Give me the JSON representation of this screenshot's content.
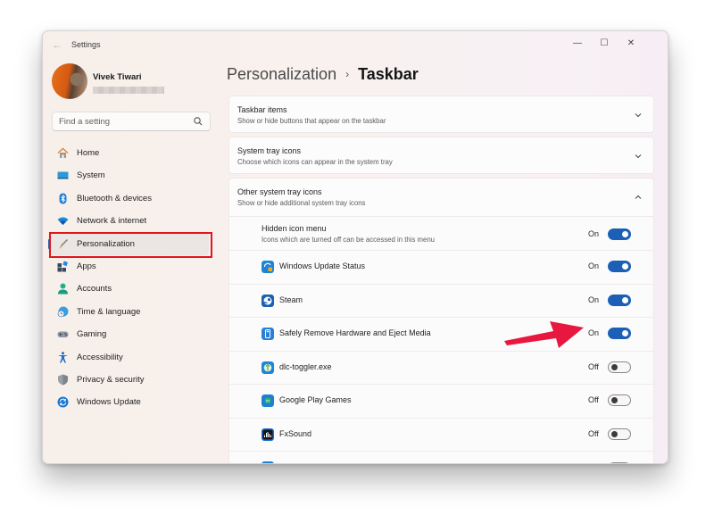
{
  "window": {
    "title": "Settings",
    "controls": {
      "minimize": "—",
      "maximize": "☐",
      "close": "✕"
    },
    "back_icon": "←"
  },
  "profile": {
    "name": "Vivek Tiwari",
    "email": ""
  },
  "search": {
    "placeholder": "Find a setting",
    "value": ""
  },
  "sidebar": {
    "items": [
      {
        "label": "Home",
        "icon": "home-icon",
        "active": false
      },
      {
        "label": "System",
        "icon": "system-icon",
        "active": false
      },
      {
        "label": "Bluetooth & devices",
        "icon": "bluetooth-icon",
        "active": false
      },
      {
        "label": "Network & internet",
        "icon": "wifi-icon",
        "active": false
      },
      {
        "label": "Personalization",
        "icon": "brush-icon",
        "active": true
      },
      {
        "label": "Apps",
        "icon": "apps-icon",
        "active": false
      },
      {
        "label": "Accounts",
        "icon": "account-icon",
        "active": false
      },
      {
        "label": "Time & language",
        "icon": "clock-globe-icon",
        "active": false
      },
      {
        "label": "Gaming",
        "icon": "gamepad-icon",
        "active": false
      },
      {
        "label": "Accessibility",
        "icon": "accessibility-icon",
        "active": false
      },
      {
        "label": "Privacy & security",
        "icon": "shield-icon",
        "active": false
      },
      {
        "label": "Windows Update",
        "icon": "update-icon",
        "active": false
      }
    ]
  },
  "breadcrumb": {
    "parent": "Personalization",
    "separator": "›",
    "current": "Taskbar"
  },
  "sections": [
    {
      "title": "Taskbar items",
      "subtitle": "Show or hide buttons that appear on the taskbar",
      "expanded": false
    },
    {
      "title": "System tray icons",
      "subtitle": "Choose which icons can appear in the system tray",
      "expanded": false
    },
    {
      "title": "Other system tray icons",
      "subtitle": "Show or hide additional system tray icons",
      "expanded": true
    }
  ],
  "hidden_icon_menu": {
    "title": "Hidden icon menu",
    "subtitle": "Icons which are turned off can be accessed in this menu",
    "state": "On",
    "on": true
  },
  "tray_icons": [
    {
      "label": "Windows Update Status",
      "icon": "windows-update-status-icon",
      "state": "On",
      "on": true
    },
    {
      "label": "Steam",
      "icon": "steam-icon",
      "state": "On",
      "on": true
    },
    {
      "label": "Safely Remove Hardware and Eject Media",
      "icon": "usb-eject-icon",
      "state": "On",
      "on": true
    },
    {
      "label": "dlc-toggler.exe",
      "icon": "dlc-toggler-icon",
      "state": "Off",
      "on": false
    },
    {
      "label": "Google Play Games",
      "icon": "google-play-games-icon",
      "state": "Off",
      "on": false
    },
    {
      "label": "FxSound",
      "icon": "fxsound-icon",
      "state": "Off",
      "on": false
    },
    {
      "label": "",
      "icon": "app-icon",
      "state": "",
      "on": false
    }
  ],
  "colors": {
    "accent": "#1b5fb6",
    "annotation_box": "#e2161b",
    "annotation_arrow": "#e8173f"
  }
}
